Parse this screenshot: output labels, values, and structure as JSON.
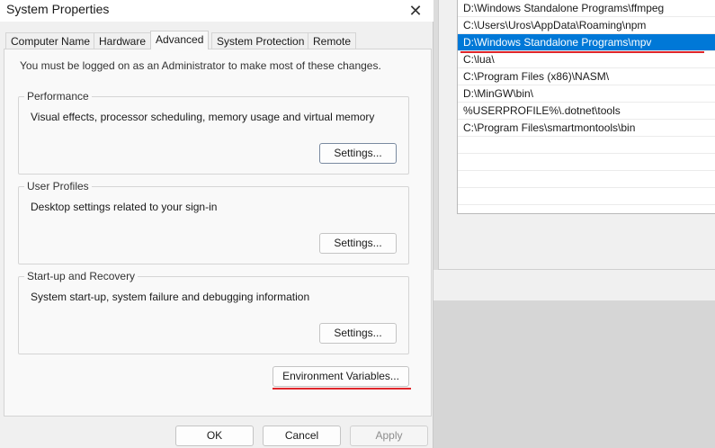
{
  "window": {
    "title": "System Properties",
    "close_icon": "close-icon"
  },
  "tabs": [
    {
      "label": "Computer Name"
    },
    {
      "label": "Hardware"
    },
    {
      "label": "Advanced"
    },
    {
      "label": "System Protection"
    },
    {
      "label": "Remote"
    }
  ],
  "advanced": {
    "admin_note": "You must be logged on as an Administrator to make most of these changes.",
    "performance": {
      "label": "Performance",
      "description": "Visual effects, processor scheduling, memory usage and virtual memory",
      "button": "Settings..."
    },
    "user_profiles": {
      "label": "User Profiles",
      "description": "Desktop settings related to your sign-in",
      "button": "Settings..."
    },
    "startup_recovery": {
      "label": "Start-up and Recovery",
      "description": "System start-up, system failure and debugging information",
      "button": "Settings..."
    },
    "env_button": "Environment Variables..."
  },
  "footer": {
    "ok": "OK",
    "cancel": "Cancel",
    "apply": "Apply"
  },
  "path_editor": {
    "rows": [
      "D:\\Windows Standalone Programs\\ffmpeg",
      "C:\\Users\\Uros\\AppData\\Roaming\\npm",
      "D:\\Windows Standalone Programs\\mpv",
      "C:\\lua\\",
      "C:\\Program Files (x86)\\NASM\\",
      "D:\\MinGW\\bin\\",
      "%USERPROFILE%\\.dotnet\\tools",
      "C:\\Program Files\\smartmontools\\bin",
      "",
      "",
      "",
      "",
      ""
    ],
    "selected_index": 2
  },
  "colors": {
    "selection": "#0078d7",
    "highlight_underline": "#e0262b"
  }
}
